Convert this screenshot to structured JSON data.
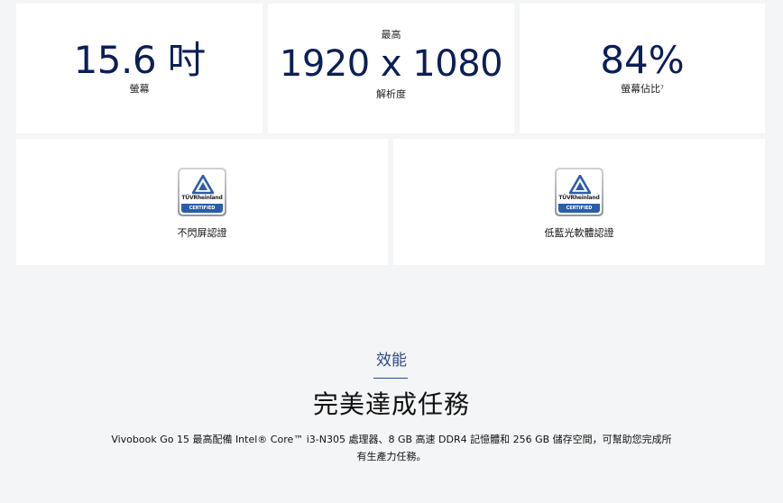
{
  "specs": [
    {
      "pre": "",
      "value": "15.6 吋",
      "label": "螢幕"
    },
    {
      "pre": "最高",
      "value": "1920 x 1080",
      "label": "解析度"
    },
    {
      "pre": "",
      "value": "84%",
      "label": "螢幕佔比",
      "sup": "7"
    }
  ],
  "certifications": [
    {
      "badge_name": "TÜVRheinland",
      "badge_sub": "CERTIFIED",
      "label": "不閃屏認證"
    },
    {
      "badge_name": "TÜVRheinland",
      "badge_sub": "CERTIFIED",
      "label": "低藍光軟體認證"
    }
  ],
  "performance": {
    "eyebrow": "效能",
    "title": "完美達成任務",
    "description": "Vivobook Go 15 最高配備 Intel® Core™ i3-N305 處理器、8 GB 高速 DDR4 記憶體和 256 GB 儲存空間，可幫助您完成所有生產力任務。"
  },
  "colors": {
    "accent": "#0b1f57",
    "eyebrow": "#2b4a8c",
    "background": "#f4f5f6",
    "card": "#ffffff",
    "tuv_blue": "#2a5ea8"
  }
}
